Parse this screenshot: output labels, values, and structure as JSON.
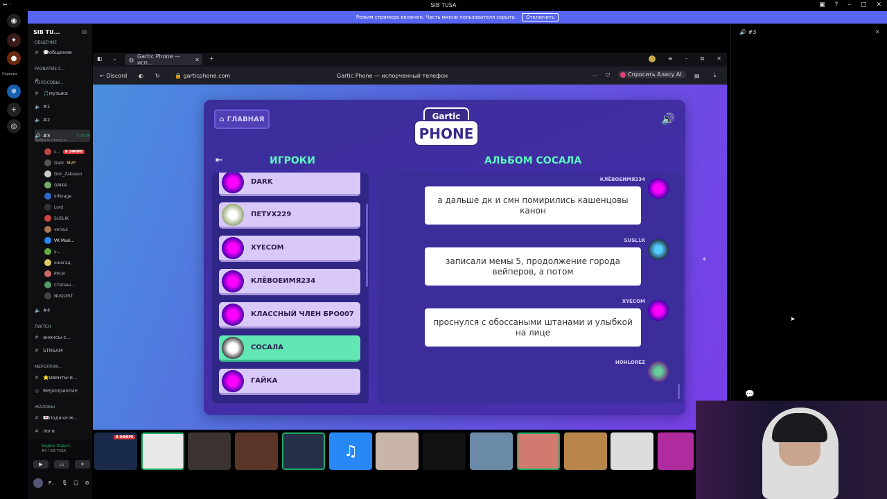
{
  "titlebar": {
    "title": "SIB TUSA"
  },
  "streamer_bar": {
    "text": "Режим стримера включен. Часть имени пользователя скрыта.",
    "button": "Отключить"
  },
  "rail": {
    "servers_label": "Сервера"
  },
  "channels": {
    "server_name": "SIB TU...",
    "items": [
      {
        "type": "cat",
        "label": "ОБЩЕНИЕ"
      },
      {
        "type": "text",
        "label": "💬общение"
      },
      {
        "type": "cat",
        "label": "РАЗВИТИЕ С..."
      },
      {
        "type": "text",
        "label": "#"
      },
      {
        "type": "cat",
        "label": "ГОЛОСОВЫ..."
      },
      {
        "type": "text",
        "label": "🎵музыка"
      },
      {
        "type": "voice",
        "label": "#1"
      },
      {
        "type": "voice",
        "label": "#2"
      },
      {
        "type": "voice",
        "label": "#3"
      },
      {
        "type": "voice",
        "label": "#4"
      },
      {
        "type": "cat",
        "label": "TWITCH"
      },
      {
        "type": "text",
        "label": "анонсы-с..."
      },
      {
        "type": "text",
        "label": "STREAM"
      },
      {
        "type": "cat",
        "label": "МЕРОПРИЯ..."
      },
      {
        "type": "text",
        "label": "⭐ивенты-и..."
      },
      {
        "type": "text",
        "label": "Мероприятие"
      },
      {
        "type": "cat",
        "label": "ЖАЛОБЫ"
      },
      {
        "type": "text",
        "label": "💌подача-ж..."
      },
      {
        "type": "text",
        "label": "логи"
      }
    ],
    "voice_timer": "5:29:06",
    "voice_status": "Выбрать статус к...",
    "live_badge": "В ЭФИРЕ",
    "users": [
      {
        "name": "с...",
        "extra": "В ЭФИРЕ"
      },
      {
        "name": "Dark",
        "extra": "MVP"
      },
      {
        "name": "Don_Zakuson",
        "extra": ""
      },
      {
        "name": "GAIKA",
        "extra": "■"
      },
      {
        "name": "Inferage",
        "extra": "■"
      },
      {
        "name": "Lord",
        "extra": "■"
      },
      {
        "name": "SUSLIK",
        "extra": "■"
      },
      {
        "name": "versus",
        "extra": ""
      },
      {
        "name": "VK Musi...",
        "extra": ""
      },
      {
        "name": "у...",
        "extra": ""
      },
      {
        "name": "ожагад",
        "extra": ""
      },
      {
        "name": "РУСЯ",
        "extra": "■"
      },
      {
        "name": "Степаш...",
        "extra": "■"
      },
      {
        "name": "NUQUIST",
        "extra": ""
      }
    ]
  },
  "voice_panel": {
    "status": "Видео подкл...",
    "channel": "#3 / SIB TUSA",
    "user": "Р..."
  },
  "right_panel": {
    "title": "#3"
  },
  "browser": {
    "tab_title": "Gartic Phone — исп...",
    "back_label": "Discord",
    "address": "garticphone.com",
    "page_title": "Gartic Phone — испорченный телефон",
    "alice_label": "Спросить Алису AI"
  },
  "game": {
    "home_label": "ГЛАВНАЯ",
    "logo_top": "Gartic",
    "logo_bottom": "PHONE",
    "players_title": "ИГРОКИ",
    "album_title": "АЛЬБОМ СОСАЛА",
    "players": [
      {
        "name": "DARK",
        "me": false
      },
      {
        "name": "ПЕТУХ229",
        "me": false
      },
      {
        "name": "XYECOM",
        "me": false
      },
      {
        "name": "КЛЁВОЕИМЯ234",
        "me": false
      },
      {
        "name": "КЛАССНЫЙ ЧЛЕН БРО007",
        "me": false
      },
      {
        "name": "СОСАЛА",
        "me": true
      },
      {
        "name": "ГАЙКА",
        "me": false
      }
    ],
    "messages": [
      {
        "author": "КЛЁВОЕИМЯ234",
        "text": "а дальше дк и смн помирились кашенцовы канон"
      },
      {
        "author": "SUSL1K",
        "text": "записали мемы 5, продолжение города вейперов, а потом"
      },
      {
        "author": "XYECOM",
        "text": "проснулся с обоссаными штанами и улыбкой на лице"
      },
      {
        "author": "HOHLOREZ",
        "text": ""
      }
    ]
  },
  "strip": {
    "live_badge": "В ЭФИРЕ"
  }
}
